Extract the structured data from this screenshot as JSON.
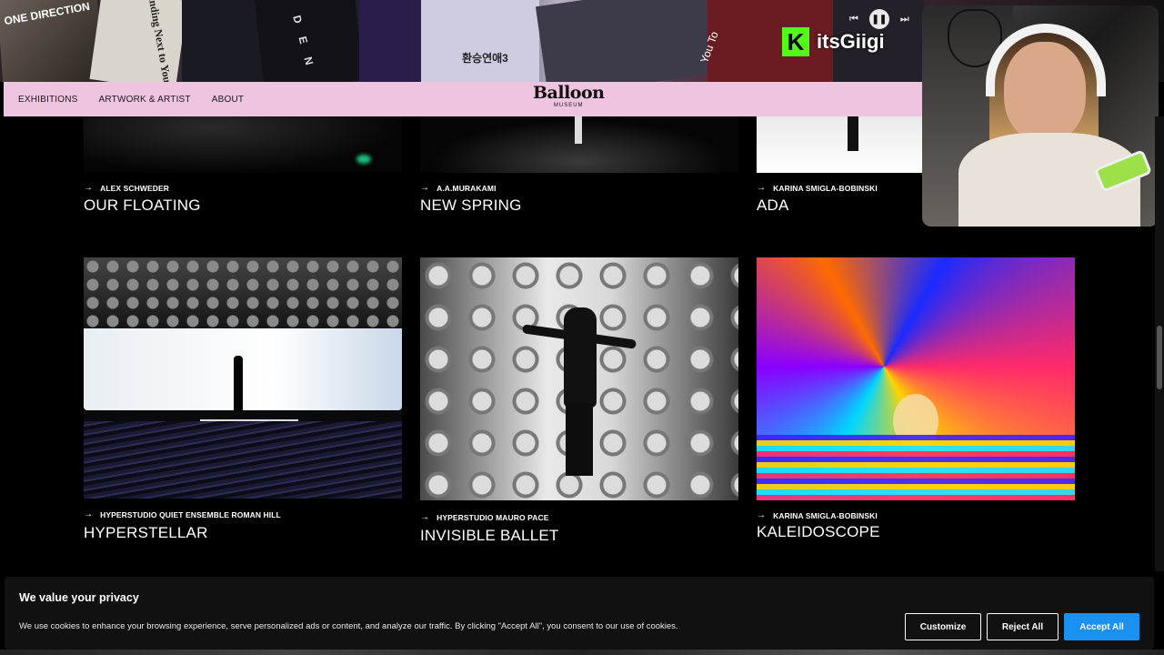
{
  "stream": {
    "collage_texts": {
      "one_direction": "ONE DIRECTION",
      "standing_next": "Standing Next to You",
      "den": "D E N",
      "korean": "환승연애3",
      "you_to": "You To"
    },
    "streamer_name": "itsGiigi",
    "platform_badge": "K",
    "media": {
      "prev": "⏮",
      "pause": "❚❚",
      "next": "⏭"
    }
  },
  "nav": {
    "items": [
      "EXHIBITIONS",
      "ARTWORK & ARTIST",
      "ABOUT"
    ],
    "logo_main": "Balloon",
    "logo_sub": "MUSEUM"
  },
  "cards": [
    {
      "artist": "ALEX SCHWEDER",
      "title": "OUR FLOATING"
    },
    {
      "artist": "A.A.MURAKAMI",
      "title": "NEW SPRING"
    },
    {
      "artist": "KARINA SMIGLA-BOBINSKI",
      "title": "ADA"
    },
    {
      "artist": "HYPERSTUDIO QUIET ENSEMBLE ROMAN HILL",
      "title": "HYPERSTELLAR"
    },
    {
      "artist": "HYPERSTUDIO MAURO PACE",
      "title": "INVISIBLE BALLET"
    },
    {
      "artist": "KARINA SMIGLA-BOBINSKI",
      "title": "KALEIDOSCOPE"
    }
  ],
  "arrow": "→",
  "cookie": {
    "heading": "We value your privacy",
    "text": "We use cookies to enhance your browsing experience, serve personalized ads or content, and analyze our traffic. By clicking \"Accept All\", you consent to our use of cookies.",
    "customize": "Customize",
    "reject": "Reject All",
    "accept": "Accept All"
  },
  "colors": {
    "nav_bg": "#efc4e0",
    "accept_bg": "#1a91f0",
    "kick_green": "#53fc18"
  }
}
